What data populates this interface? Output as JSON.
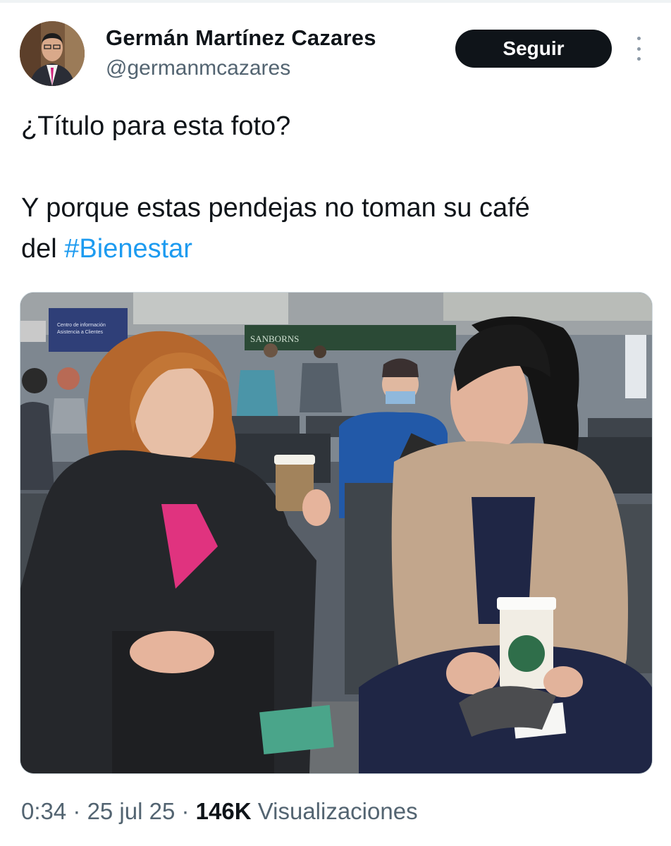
{
  "author": {
    "name": "Germán Martínez Cazares",
    "handle": "@germanmcazares"
  },
  "actions": {
    "follow_label": "Seguir"
  },
  "tweet": {
    "line1": "¿Título para esta foto?",
    "line2": "Y porque estas pendejas no toman su café",
    "line3_prefix": "del ",
    "hashtag": "#Bienestar"
  },
  "photo": {
    "sign_info": "Centro de información\nAsistencia a Clientes",
    "sign_store": "SANBORNS"
  },
  "meta": {
    "time": "0:34",
    "sep1": " · ",
    "date": "25 jul 25",
    "sep2": " · ",
    "views": "146K",
    "views_label": " Visualizaciones"
  },
  "colors": {
    "link": "#1d9bf0",
    "follow_bg": "#0f1419",
    "secondary_text": "#536471"
  }
}
